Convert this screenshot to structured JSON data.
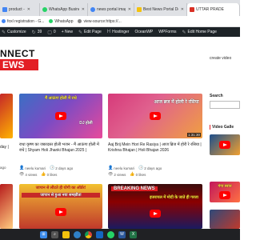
{
  "browser": {
    "tabs": [
      {
        "label": "product - ",
        "color": "#4285f4"
      },
      {
        "label": "WhatsApp Business",
        "color": "#25d366"
      },
      {
        "label": "news portal image",
        "color": "#4285f4"
      },
      {
        "label": "Best News Portal Do",
        "color": "#f4c20d"
      },
      {
        "label": "UTTAR PRADE",
        "color": "#d93025"
      }
    ],
    "bookmarks": [
      {
        "label": "foxl registration - G...",
        "color": "#4285f4"
      },
      {
        "label": "WhatsApp",
        "color": "#25d366"
      },
      {
        "label": "view-source:https://...",
        "color": "#888888"
      }
    ]
  },
  "adminbar": {
    "items": [
      "Customize",
      "39",
      "0",
      "+ New",
      "Edit Page",
      "Hostinger",
      "OceanWP",
      "WPForms",
      "Edit Home Page"
    ]
  },
  "site": {
    "logo_line1": "NNECT",
    "logo_line2": "EWS",
    "create_video": "create video"
  },
  "videos": [
    {
      "thumb_text": "मैं आऊंगा होली में राधे",
      "thumb_text2": "DJ होली",
      "title": "राधा कृष्ण का जबरदस्त होली भजन - मैं आऊंगा होली में राधे | Shyam Holi Jhanki Bhajan 2025 |",
      "author": "neelu kumari",
      "date": "2 days ago",
      "views": "4 views",
      "likes": "0 likes",
      "duration": "",
      "bg1": "#3a6fc4",
      "bg2": "#e84a9b"
    },
    {
      "thumb_text": "आज ब्रज में होली रे रसिया",
      "thumb_text2": "",
      "title": "Aaj Brij Mein Hori Re Rasiya | आज ब्रिज में होरी रे रसिया | Krishna Bhajan | Holi Bhajan 2026",
      "author": "neelu kumari",
      "date": "2 days ago",
      "views": "2 views",
      "likes": "0 likes",
      "duration": "1:31:30",
      "bg1": "#d63a7a",
      "bg2": "#f0a040"
    },
    {
      "thumb_text": "जापान से लौटते ही योगी का ऑर्डर!",
      "thumb_text2": "जापान से हुआ नया समझौता",
      "title": "",
      "duration": "",
      "bg1": "#f2c230",
      "bg2": "#c0392b"
    },
    {
      "thumb_text": "BREAKING NEWS",
      "thumb_text2": "इजरायल में मोदी के जाते ही गरजा",
      "title": "",
      "duration": "",
      "bg1": "#8b0000",
      "bg2": "#1a1a60"
    }
  ],
  "partial_left": {
    "title_line1": "day |",
    "title_line2": "ago"
  },
  "sidebar": {
    "search_label": "Search",
    "gallery_title": "Video Galle",
    "thumbs": [
      {
        "color1": "#1d4f8c",
        "color2": "#f0a030"
      },
      {
        "color1": "#c2185b",
        "color2": "#ff7043",
        "text": "गंगा स्नान"
      },
      {
        "color1": "#2e4a7a",
        "color2": "#c0392b"
      }
    ]
  },
  "colors": {
    "adminbar": "#1d2327",
    "brand_red": "#e31e24",
    "taskbar": "#202124"
  },
  "taskbar": {
    "icons": [
      {
        "name": "windows-icon",
        "color": "#3b8beb"
      },
      {
        "name": "search-icon",
        "color": "#555555"
      },
      {
        "name": "file-explorer-icon",
        "color": "#f4c20d"
      },
      {
        "name": "edge-icon",
        "color": "#2f80c7"
      },
      {
        "name": "chrome-icon",
        "color": "#4caf50"
      },
      {
        "name": "store-icon",
        "color": "#1565c0"
      },
      {
        "name": "whatsapp-icon",
        "color": "#25d366"
      },
      {
        "name": "word-icon",
        "color": "#2b579a"
      },
      {
        "name": "excel-icon",
        "color": "#217346"
      }
    ]
  }
}
